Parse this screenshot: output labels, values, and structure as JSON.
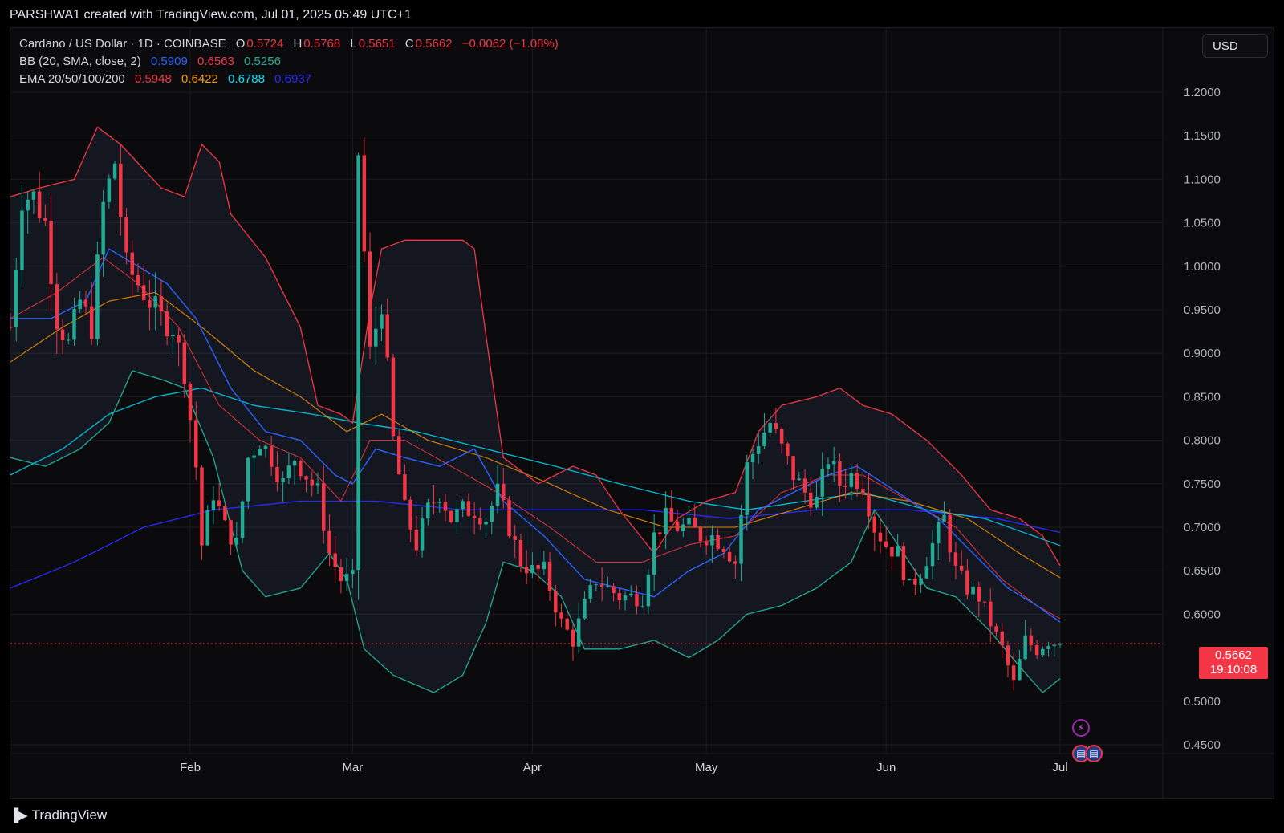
{
  "header": {
    "text": "PARSHWA1 created with TradingView.com, Jul 01, 2025 05:49 UTC+1"
  },
  "legend": {
    "symbol": "Cardano / US Dollar · 1D · COINBASE",
    "ohlc": {
      "o_label": "O",
      "o": "0.5724",
      "h_label": "H",
      "h": "0.5768",
      "l_label": "L",
      "l": "0.5651",
      "c_label": "C",
      "c": "0.5662",
      "change": "−0.0062 (−1.08%)"
    },
    "bb": {
      "label": "BB (20, SMA, close, 2)",
      "basis": "0.5909",
      "upper": "0.6563",
      "lower": "0.5256"
    },
    "ema": {
      "label": "EMA 20/50/100/200",
      "e20": "0.5948",
      "e50": "0.6422",
      "e100": "0.6788",
      "e200": "0.6937"
    }
  },
  "currency_button": "USD",
  "last_price": {
    "price": "0.5662",
    "countdown": "19:10:08"
  },
  "footer": {
    "brand": "TradingView"
  },
  "icons": [
    "lightning-icon",
    "us-flag-icon",
    "us-flag-icon"
  ],
  "colors": {
    "up": "#22ab94",
    "down": "#f23645",
    "bb_upper": "#f23645",
    "bb_lower": "#22ab94",
    "bb_basis": "#2962ff",
    "ema20": "#f23645",
    "ema50": "#ff9800",
    "ema100": "#00bcd4",
    "ema200": "#2a2aff"
  },
  "chart_data": {
    "type": "candlestick",
    "symbol": "ADA/USD",
    "timeframe": "1D",
    "y_axis": {
      "ticks": [
        "1.2000",
        "1.1500",
        "1.1000",
        "1.0500",
        "1.0000",
        "0.9500",
        "0.9000",
        "0.8500",
        "0.8000",
        "0.7500",
        "0.7000",
        "0.6500",
        "0.6000",
        "0.5000",
        "0.4500"
      ],
      "range": [
        0.43,
        1.23
      ]
    },
    "x_axis": {
      "ticks": [
        "Feb",
        "Mar",
        "Apr",
        "May",
        "Jun",
        "Jul"
      ]
    },
    "x_range": [
      "2025-01-01",
      "2025-07-01"
    ],
    "anchors": [
      [
        "2025-01-01",
        0.93
      ],
      [
        "2025-01-03",
        1.08
      ],
      [
        "2025-01-05",
        1.08
      ],
      [
        "2025-01-07",
        1.05
      ],
      [
        "2025-01-09",
        0.94
      ],
      [
        "2025-01-11",
        0.91
      ],
      [
        "2025-01-13",
        0.96
      ],
      [
        "2025-01-15",
        0.93
      ],
      [
        "2025-01-17",
        1.07
      ],
      [
        "2025-01-19",
        1.12
      ],
      [
        "2025-01-21",
        1.0
      ],
      [
        "2025-01-23",
        0.98
      ],
      [
        "2025-01-25",
        0.96
      ],
      [
        "2025-01-27",
        0.94
      ],
      [
        "2025-01-29",
        0.93
      ],
      [
        "2025-01-31",
        0.88
      ],
      [
        "2025-02-02",
        0.77
      ],
      [
        "2025-02-03",
        0.68
      ],
      [
        "2025-02-05",
        0.74
      ],
      [
        "2025-02-07",
        0.7
      ],
      [
        "2025-02-09",
        0.68
      ],
      [
        "2025-02-11",
        0.78
      ],
      [
        "2025-02-13",
        0.8
      ],
      [
        "2025-02-15",
        0.78
      ],
      [
        "2025-02-17",
        0.75
      ],
      [
        "2025-02-19",
        0.78
      ],
      [
        "2025-02-21",
        0.76
      ],
      [
        "2025-02-23",
        0.74
      ],
      [
        "2025-02-25",
        0.67
      ],
      [
        "2025-02-27",
        0.64
      ],
      [
        "2025-03-01",
        0.64
      ],
      [
        "2025-03-02",
        1.13
      ],
      [
        "2025-03-04",
        0.9
      ],
      [
        "2025-03-06",
        0.96
      ],
      [
        "2025-03-08",
        0.8
      ],
      [
        "2025-03-10",
        0.72
      ],
      [
        "2025-03-12",
        0.68
      ],
      [
        "2025-03-14",
        0.72
      ],
      [
        "2025-03-16",
        0.74
      ],
      [
        "2025-03-18",
        0.71
      ],
      [
        "2025-03-20",
        0.72
      ],
      [
        "2025-03-22",
        0.72
      ],
      [
        "2025-03-24",
        0.71
      ],
      [
        "2025-03-26",
        0.74
      ],
      [
        "2025-03-28",
        0.7
      ],
      [
        "2025-03-30",
        0.66
      ],
      [
        "2025-04-01",
        0.65
      ],
      [
        "2025-04-03",
        0.65
      ],
      [
        "2025-04-06",
        0.59
      ],
      [
        "2025-04-08",
        0.57
      ],
      [
        "2025-04-10",
        0.61
      ],
      [
        "2025-04-12",
        0.64
      ],
      [
        "2025-04-14",
        0.63
      ],
      [
        "2025-04-16",
        0.62
      ],
      [
        "2025-04-18",
        0.62
      ],
      [
        "2025-04-20",
        0.62
      ],
      [
        "2025-04-22",
        0.69
      ],
      [
        "2025-04-24",
        0.71
      ],
      [
        "2025-04-26",
        0.7
      ],
      [
        "2025-04-28",
        0.7
      ],
      [
        "2025-04-30",
        0.69
      ],
      [
        "2025-05-02",
        0.69
      ],
      [
        "2025-05-04",
        0.68
      ],
      [
        "2025-05-06",
        0.66
      ],
      [
        "2025-05-08",
        0.77
      ],
      [
        "2025-05-10",
        0.8
      ],
      [
        "2025-05-12",
        0.82
      ],
      [
        "2025-05-14",
        0.79
      ],
      [
        "2025-05-16",
        0.76
      ],
      [
        "2025-05-18",
        0.74
      ],
      [
        "2025-05-20",
        0.73
      ],
      [
        "2025-05-22",
        0.78
      ],
      [
        "2025-05-24",
        0.75
      ],
      [
        "2025-05-26",
        0.76
      ],
      [
        "2025-05-28",
        0.75
      ],
      [
        "2025-05-30",
        0.7
      ],
      [
        "2025-06-01",
        0.68
      ],
      [
        "2025-06-03",
        0.67
      ],
      [
        "2025-06-05",
        0.63
      ],
      [
        "2025-06-07",
        0.65
      ],
      [
        "2025-06-09",
        0.68
      ],
      [
        "2025-06-11",
        0.71
      ],
      [
        "2025-06-13",
        0.65
      ],
      [
        "2025-06-15",
        0.63
      ],
      [
        "2025-06-17",
        0.62
      ],
      [
        "2025-06-19",
        0.59
      ],
      [
        "2025-06-21",
        0.56
      ],
      [
        "2025-06-23",
        0.52
      ],
      [
        "2025-06-25",
        0.57
      ],
      [
        "2025-06-27",
        0.56
      ],
      [
        "2025-06-29",
        0.57
      ],
      [
        "2025-07-01",
        0.566
      ]
    ],
    "bb_upper_anchors": [
      [
        "2025-01-01",
        1.08
      ],
      [
        "2025-01-06",
        1.09
      ],
      [
        "2025-01-12",
        1.1
      ],
      [
        "2025-01-16",
        1.16
      ],
      [
        "2025-01-20",
        1.14
      ],
      [
        "2025-01-27",
        1.09
      ],
      [
        "2025-01-31",
        1.08
      ],
      [
        "2025-02-03",
        1.14
      ],
      [
        "2025-02-06",
        1.12
      ],
      [
        "2025-02-08",
        1.06
      ],
      [
        "2025-02-14",
        1.01
      ],
      [
        "2025-02-20",
        0.93
      ],
      [
        "2025-02-23",
        0.84
      ],
      [
        "2025-02-27",
        0.83
      ],
      [
        "2025-03-01",
        0.82
      ],
      [
        "2025-03-04",
        0.95
      ],
      [
        "2025-03-06",
        1.02
      ],
      [
        "2025-03-10",
        1.03
      ],
      [
        "2025-03-20",
        1.03
      ],
      [
        "2025-03-22",
        1.02
      ],
      [
        "2025-03-24",
        0.92
      ],
      [
        "2025-03-27",
        0.78
      ],
      [
        "2025-04-02",
        0.75
      ],
      [
        "2025-04-08",
        0.77
      ],
      [
        "2025-04-12",
        0.76
      ],
      [
        "2025-04-16",
        0.72
      ],
      [
        "2025-04-22",
        0.67
      ],
      [
        "2025-04-26",
        0.71
      ],
      [
        "2025-05-01",
        0.73
      ],
      [
        "2025-05-06",
        0.74
      ],
      [
        "2025-05-10",
        0.81
      ],
      [
        "2025-05-14",
        0.84
      ],
      [
        "2025-05-20",
        0.85
      ],
      [
        "2025-05-24",
        0.86
      ],
      [
        "2025-05-28",
        0.84
      ],
      [
        "2025-06-02",
        0.83
      ],
      [
        "2025-06-08",
        0.8
      ],
      [
        "2025-06-14",
        0.76
      ],
      [
        "2025-06-19",
        0.72
      ],
      [
        "2025-06-24",
        0.71
      ],
      [
        "2025-06-28",
        0.69
      ],
      [
        "2025-07-01",
        0.656
      ]
    ],
    "bb_lower_anchors": [
      [
        "2025-01-01",
        0.78
      ],
      [
        "2025-01-07",
        0.77
      ],
      [
        "2025-01-13",
        0.79
      ],
      [
        "2025-01-18",
        0.82
      ],
      [
        "2025-01-22",
        0.88
      ],
      [
        "2025-01-27",
        0.87
      ],
      [
        "2025-01-31",
        0.86
      ],
      [
        "2025-02-05",
        0.78
      ],
      [
        "2025-02-10",
        0.65
      ],
      [
        "2025-02-14",
        0.62
      ],
      [
        "2025-02-20",
        0.63
      ],
      [
        "2025-02-25",
        0.67
      ],
      [
        "2025-02-28",
        0.64
      ],
      [
        "2025-03-03",
        0.56
      ],
      [
        "2025-03-08",
        0.53
      ],
      [
        "2025-03-15",
        0.51
      ],
      [
        "2025-03-20",
        0.53
      ],
      [
        "2025-03-24",
        0.59
      ],
      [
        "2025-03-27",
        0.66
      ],
      [
        "2025-04-01",
        0.65
      ],
      [
        "2025-04-06",
        0.62
      ],
      [
        "2025-04-10",
        0.56
      ],
      [
        "2025-04-16",
        0.56
      ],
      [
        "2025-04-22",
        0.57
      ],
      [
        "2025-04-28",
        0.55
      ],
      [
        "2025-05-03",
        0.57
      ],
      [
        "2025-05-08",
        0.6
      ],
      [
        "2025-05-14",
        0.61
      ],
      [
        "2025-05-20",
        0.63
      ],
      [
        "2025-05-26",
        0.66
      ],
      [
        "2025-05-30",
        0.72
      ],
      [
        "2025-06-03",
        0.68
      ],
      [
        "2025-06-08",
        0.63
      ],
      [
        "2025-06-13",
        0.62
      ],
      [
        "2025-06-19",
        0.58
      ],
      [
        "2025-06-24",
        0.54
      ],
      [
        "2025-06-28",
        0.51
      ],
      [
        "2025-07-01",
        0.526
      ]
    ],
    "bb_basis_anchors": [
      [
        "2025-01-01",
        0.94
      ],
      [
        "2025-01-08",
        0.94
      ],
      [
        "2025-01-14",
        0.96
      ],
      [
        "2025-01-18",
        1.02
      ],
      [
        "2025-01-23",
        1.0
      ],
      [
        "2025-01-28",
        0.98
      ],
      [
        "2025-02-02",
        0.94
      ],
      [
        "2025-02-08",
        0.86
      ],
      [
        "2025-02-14",
        0.81
      ],
      [
        "2025-02-20",
        0.8
      ],
      [
        "2025-02-26",
        0.76
      ],
      [
        "2025-03-01",
        0.75
      ],
      [
        "2025-03-05",
        0.79
      ],
      [
        "2025-03-10",
        0.78
      ],
      [
        "2025-03-16",
        0.77
      ],
      [
        "2025-03-22",
        0.79
      ],
      [
        "2025-03-27",
        0.73
      ],
      [
        "2025-04-03",
        0.69
      ],
      [
        "2025-04-10",
        0.64
      ],
      [
        "2025-04-16",
        0.63
      ],
      [
        "2025-04-22",
        0.62
      ],
      [
        "2025-04-28",
        0.65
      ],
      [
        "2025-05-04",
        0.67
      ],
      [
        "2025-05-10",
        0.72
      ],
      [
        "2025-05-16",
        0.74
      ],
      [
        "2025-05-22",
        0.76
      ],
      [
        "2025-05-27",
        0.77
      ],
      [
        "2025-06-03",
        0.74
      ],
      [
        "2025-06-10",
        0.71
      ],
      [
        "2025-06-16",
        0.67
      ],
      [
        "2025-06-22",
        0.63
      ],
      [
        "2025-06-27",
        0.61
      ],
      [
        "2025-07-01",
        0.591
      ]
    ],
    "ema20_anchors": [
      [
        "2025-01-01",
        0.94
      ],
      [
        "2025-01-09",
        0.97
      ],
      [
        "2025-01-17",
        1.01
      ],
      [
        "2025-01-23",
        0.98
      ],
      [
        "2025-01-30",
        0.93
      ],
      [
        "2025-02-06",
        0.84
      ],
      [
        "2025-02-13",
        0.8
      ],
      [
        "2025-02-20",
        0.78
      ],
      [
        "2025-02-27",
        0.73
      ],
      [
        "2025-03-04",
        0.8
      ],
      [
        "2025-03-10",
        0.8
      ],
      [
        "2025-03-18",
        0.77
      ],
      [
        "2025-03-26",
        0.74
      ],
      [
        "2025-04-04",
        0.7
      ],
      [
        "2025-04-12",
        0.66
      ],
      [
        "2025-04-20",
        0.66
      ],
      [
        "2025-04-28",
        0.68
      ],
      [
        "2025-05-06",
        0.69
      ],
      [
        "2025-05-14",
        0.74
      ],
      [
        "2025-05-22",
        0.76
      ],
      [
        "2025-05-28",
        0.76
      ],
      [
        "2025-06-05",
        0.73
      ],
      [
        "2025-06-13",
        0.7
      ],
      [
        "2025-06-21",
        0.64
      ],
      [
        "2025-06-27",
        0.61
      ],
      [
        "2025-07-01",
        0.595
      ]
    ],
    "ema50_anchors": [
      [
        "2025-01-01",
        0.89
      ],
      [
        "2025-01-10",
        0.93
      ],
      [
        "2025-01-18",
        0.96
      ],
      [
        "2025-01-26",
        0.97
      ],
      [
        "2025-02-03",
        0.93
      ],
      [
        "2025-02-12",
        0.88
      ],
      [
        "2025-02-20",
        0.85
      ],
      [
        "2025-02-28",
        0.81
      ],
      [
        "2025-03-06",
        0.83
      ],
      [
        "2025-03-14",
        0.8
      ],
      [
        "2025-03-24",
        0.78
      ],
      [
        "2025-04-04",
        0.75
      ],
      [
        "2025-04-14",
        0.72
      ],
      [
        "2025-04-24",
        0.7
      ],
      [
        "2025-05-06",
        0.7
      ],
      [
        "2025-05-16",
        0.72
      ],
      [
        "2025-05-26",
        0.74
      ],
      [
        "2025-06-05",
        0.73
      ],
      [
        "2025-06-15",
        0.71
      ],
      [
        "2025-06-24",
        0.67
      ],
      [
        "2025-07-01",
        0.642
      ]
    ],
    "ema100_anchors": [
      [
        "2025-01-01",
        0.76
      ],
      [
        "2025-01-10",
        0.79
      ],
      [
        "2025-01-18",
        0.83
      ],
      [
        "2025-01-26",
        0.85
      ],
      [
        "2025-02-03",
        0.86
      ],
      [
        "2025-02-12",
        0.84
      ],
      [
        "2025-02-22",
        0.83
      ],
      [
        "2025-03-02",
        0.82
      ],
      [
        "2025-03-12",
        0.81
      ],
      [
        "2025-03-24",
        0.79
      ],
      [
        "2025-04-05",
        0.77
      ],
      [
        "2025-04-16",
        0.75
      ],
      [
        "2025-04-28",
        0.73
      ],
      [
        "2025-05-08",
        0.72
      ],
      [
        "2025-05-18",
        0.73
      ],
      [
        "2025-05-28",
        0.74
      ],
      [
        "2025-06-08",
        0.72
      ],
      [
        "2025-06-18",
        0.71
      ],
      [
        "2025-07-01",
        0.679
      ]
    ],
    "ema200_anchors": [
      [
        "2025-01-01",
        0.63
      ],
      [
        "2025-01-12",
        0.66
      ],
      [
        "2025-01-24",
        0.7
      ],
      [
        "2025-02-05",
        0.72
      ],
      [
        "2025-02-20",
        0.73
      ],
      [
        "2025-03-05",
        0.73
      ],
      [
        "2025-03-20",
        0.72
      ],
      [
        "2025-04-05",
        0.72
      ],
      [
        "2025-04-20",
        0.72
      ],
      [
        "2025-05-05",
        0.71
      ],
      [
        "2025-05-20",
        0.72
      ],
      [
        "2025-06-05",
        0.72
      ],
      [
        "2025-06-20",
        0.71
      ],
      [
        "2025-07-01",
        0.694
      ]
    ],
    "last_close": 0.5662
  }
}
